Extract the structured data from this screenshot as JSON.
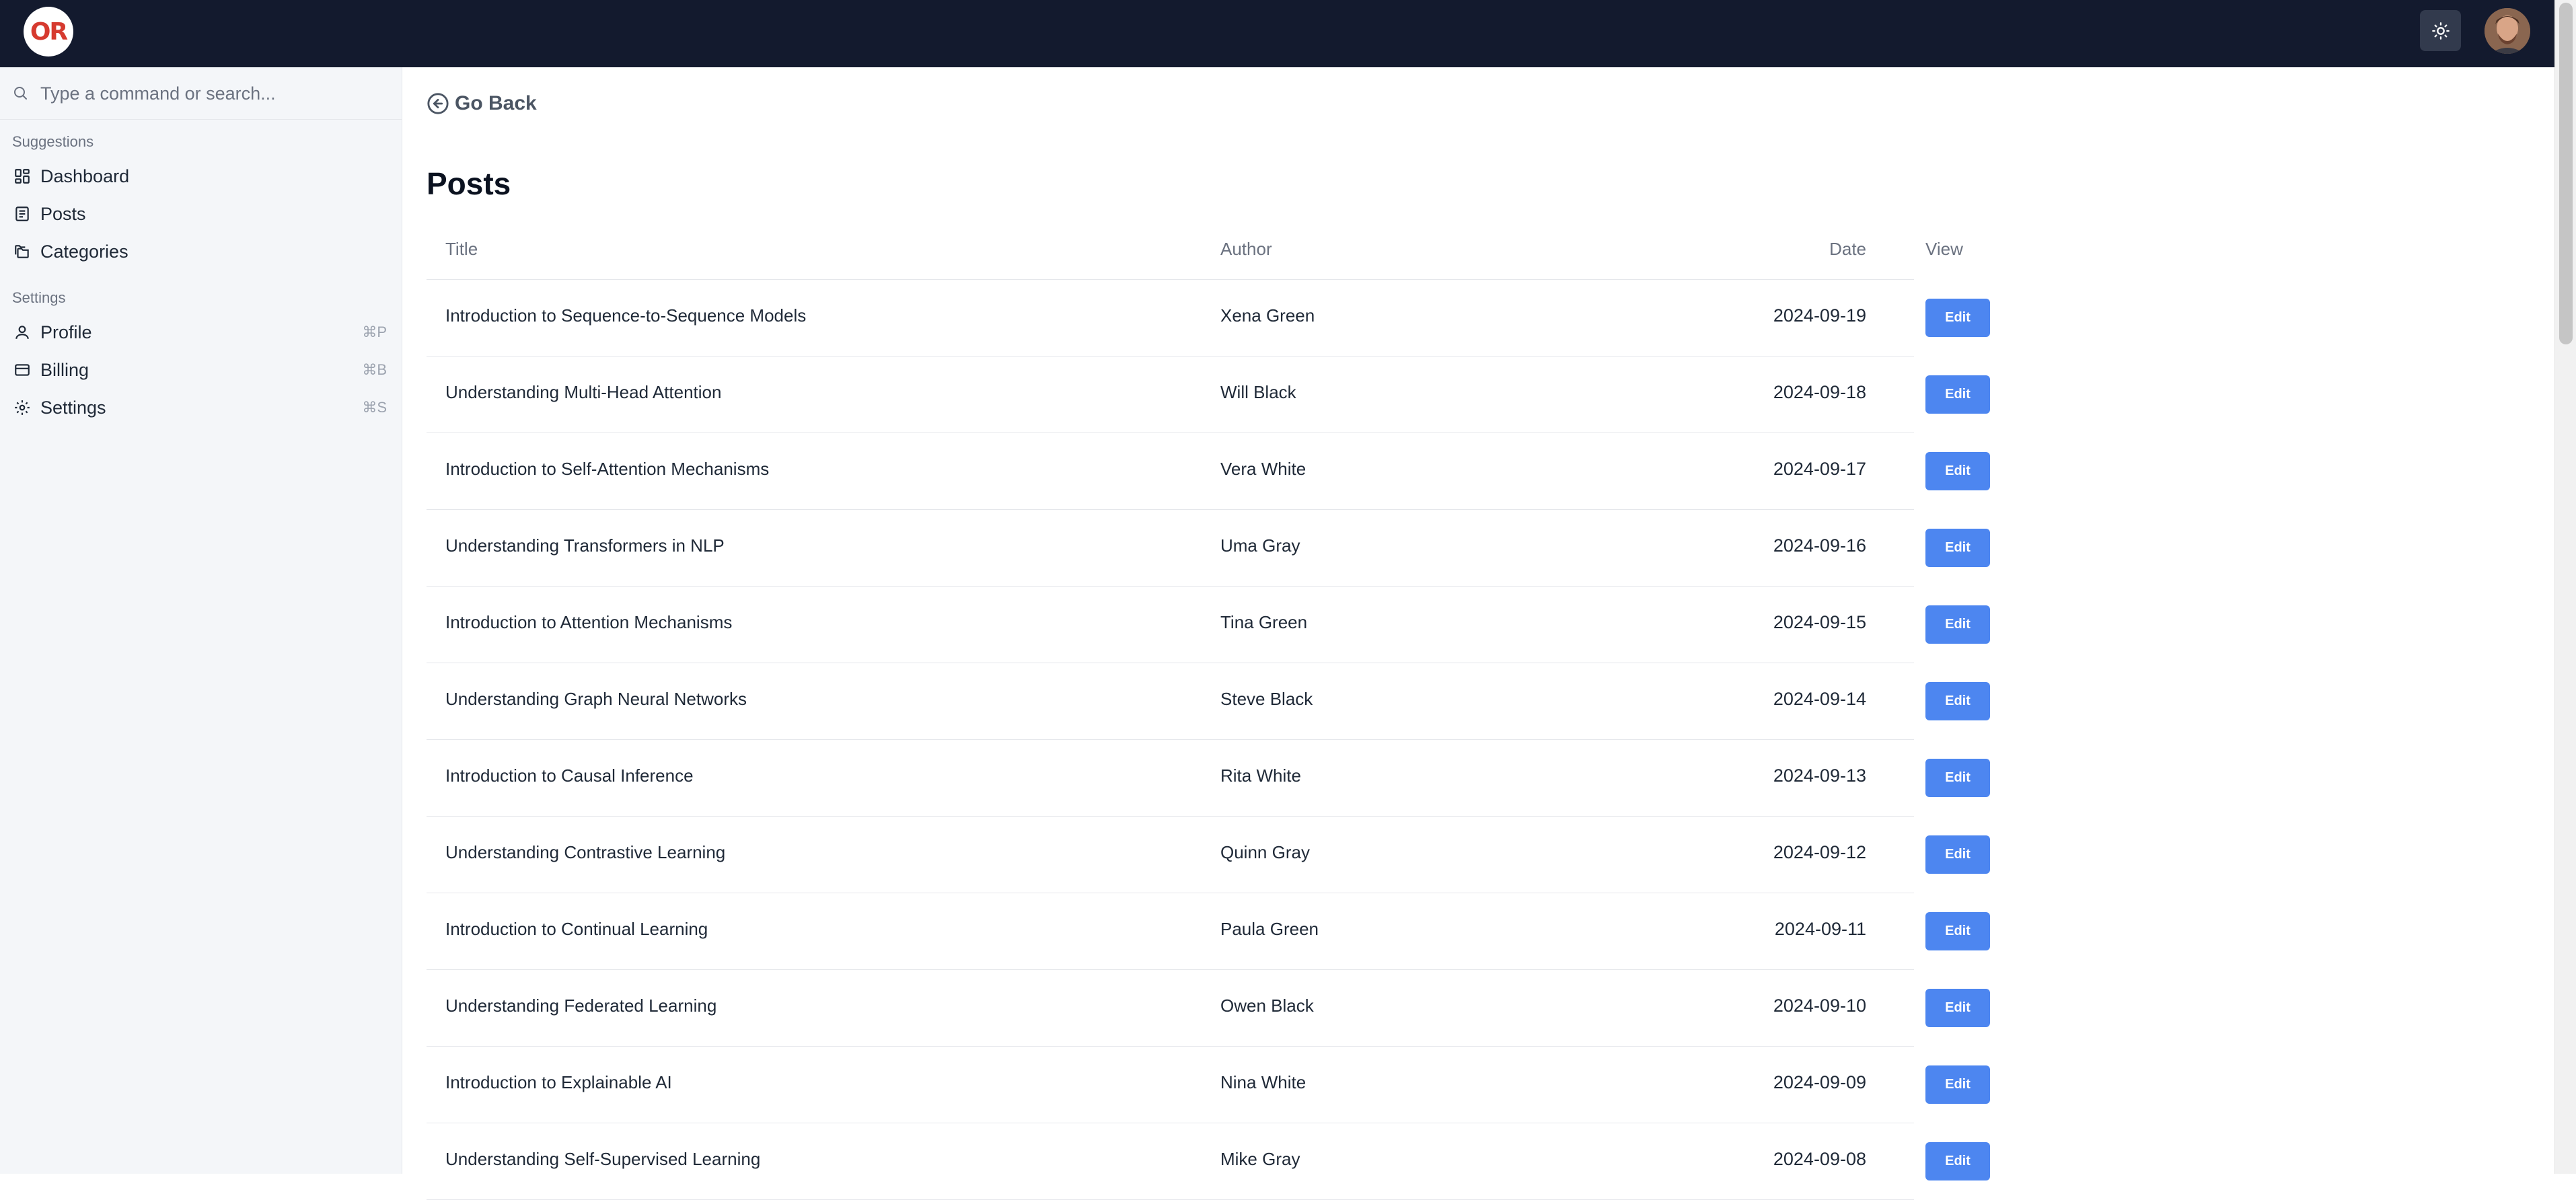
{
  "topbar": {
    "logo_text": "OR",
    "theme_icon": "sun-icon",
    "avatar_icon": "user-avatar"
  },
  "sidebar": {
    "search_placeholder": "Type a command or search...",
    "suggestions_label": "Suggestions",
    "suggestions": [
      {
        "label": "Dashboard",
        "icon": "dashboard-icon"
      },
      {
        "label": "Posts",
        "icon": "newspaper-icon"
      },
      {
        "label": "Categories",
        "icon": "folders-icon"
      }
    ],
    "settings_label": "Settings",
    "settings": [
      {
        "label": "Profile",
        "icon": "user-icon",
        "shortcut": "⌘P"
      },
      {
        "label": "Billing",
        "icon": "credit-card-icon",
        "shortcut": "⌘B"
      },
      {
        "label": "Settings",
        "icon": "gear-icon",
        "shortcut": "⌘S"
      }
    ]
  },
  "main": {
    "go_back": "Go Back",
    "title": "Posts",
    "columns": {
      "title": "Title",
      "author": "Author",
      "date": "Date",
      "view": "View"
    },
    "edit_label": "Edit",
    "rows": [
      {
        "title": "Introduction to Sequence-to-Sequence Models",
        "author": "Xena Green",
        "date": "2024-09-19"
      },
      {
        "title": "Understanding Multi-Head Attention",
        "author": "Will Black",
        "date": "2024-09-18"
      },
      {
        "title": "Introduction to Self-Attention Mechanisms",
        "author": "Vera White",
        "date": "2024-09-17"
      },
      {
        "title": "Understanding Transformers in NLP",
        "author": "Uma Gray",
        "date": "2024-09-16"
      },
      {
        "title": "Introduction to Attention Mechanisms",
        "author": "Tina Green",
        "date": "2024-09-15"
      },
      {
        "title": "Understanding Graph Neural Networks",
        "author": "Steve Black",
        "date": "2024-09-14"
      },
      {
        "title": "Introduction to Causal Inference",
        "author": "Rita White",
        "date": "2024-09-13"
      },
      {
        "title": "Understanding Contrastive Learning",
        "author": "Quinn Gray",
        "date": "2024-09-12"
      },
      {
        "title": "Introduction to Continual Learning",
        "author": "Paula Green",
        "date": "2024-09-11"
      },
      {
        "title": "Understanding Federated Learning",
        "author": "Owen Black",
        "date": "2024-09-10"
      },
      {
        "title": "Introduction to Explainable AI",
        "author": "Nina White",
        "date": "2024-09-09"
      },
      {
        "title": "Understanding Self-Supervised Learning",
        "author": "Mike Gray",
        "date": "2024-09-08"
      }
    ]
  },
  "colors": {
    "navbar": "#131a2e",
    "accent": "#4d86f0",
    "sidebar_bg": "#f4f6f9",
    "logo_red": "#d63a2f"
  }
}
